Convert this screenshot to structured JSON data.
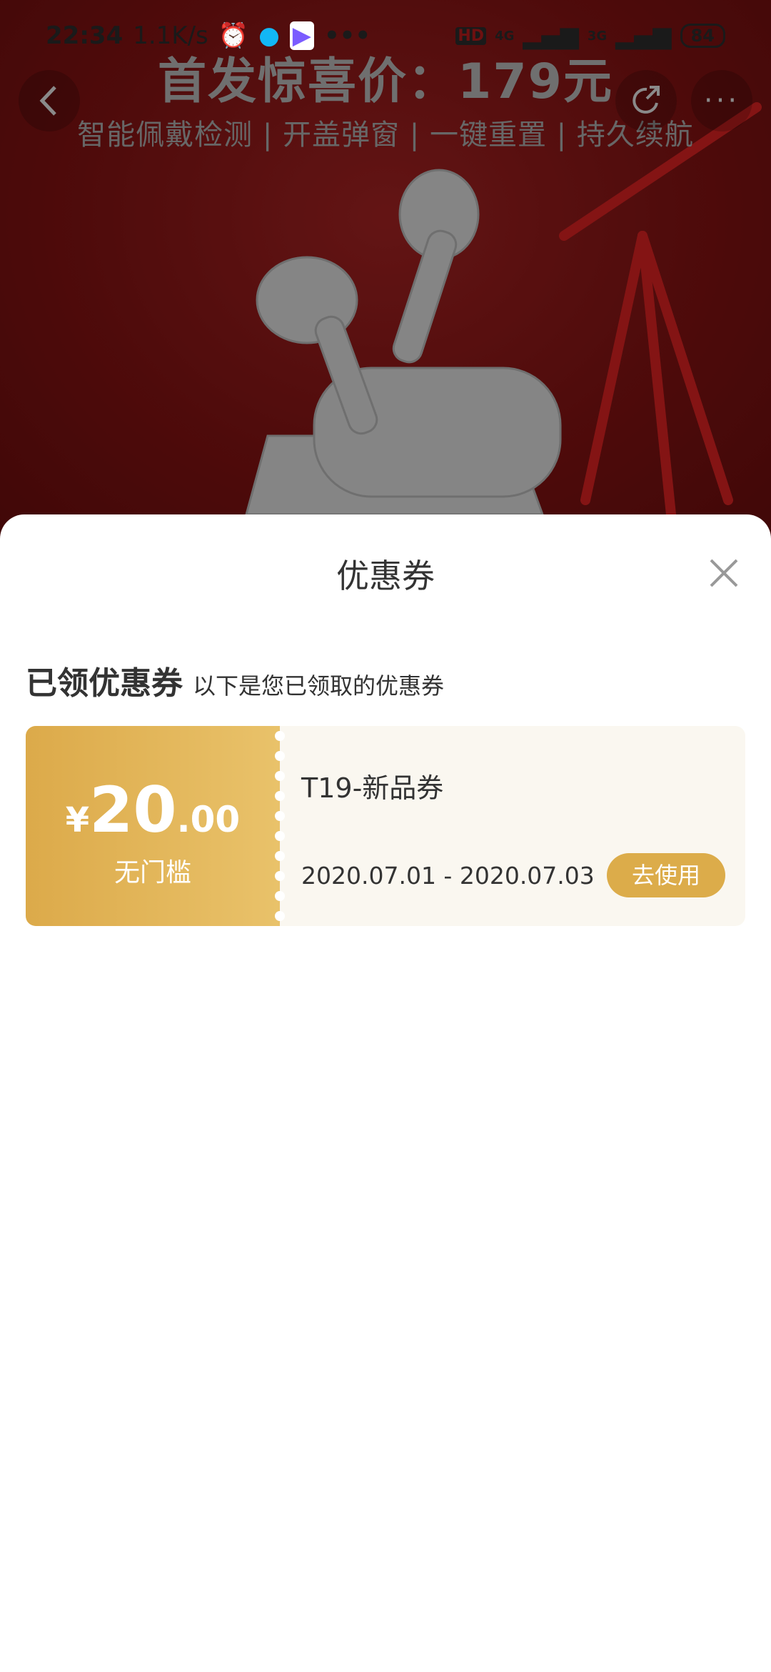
{
  "status_bar": {
    "time": "22:34",
    "speed": "1.1K/s",
    "hd": "HD",
    "net1": "4G",
    "net2": "3G",
    "battery": "84"
  },
  "banner": {
    "headline": "首发惊喜价：179元",
    "subline": "智能佩戴检测 | 开盖弹窗 | 一键重置 | 持久续航"
  },
  "sheet": {
    "title": "优惠券",
    "section_title": "已领优惠券",
    "section_subtitle": "以下是您已领取的优惠券"
  },
  "coupon": {
    "currency": "¥",
    "amount_int": "20",
    "amount_dec": ".00",
    "condition": "无门槛",
    "name": "T19-新品券",
    "validity": "2020.07.01 - 2020.07.03",
    "action": "去使用"
  },
  "colors": {
    "accent_gold": "#dcac4a",
    "coupon_bg": "#faf7f0",
    "banner_red": "#6e1010"
  }
}
